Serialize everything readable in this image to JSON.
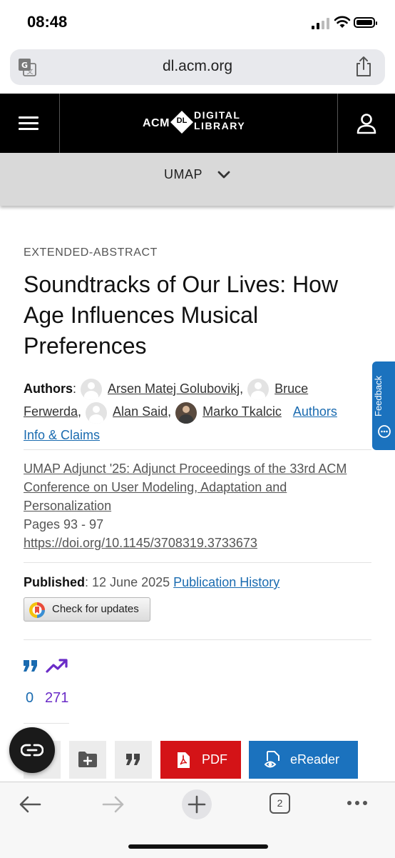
{
  "status_bar": {
    "time": "08:48"
  },
  "browser": {
    "url": "dl.acm.org",
    "tab_count": "2"
  },
  "site": {
    "logo_acm": "ACM",
    "logo_dl": "DL",
    "logo_line1": "DIGITAL",
    "logo_line2": "LIBRARY",
    "conference": "UMAP"
  },
  "article": {
    "type": "EXTENDED-ABSTRACT",
    "title": "Soundtracks of Our Lives: How Age Influences Musical Preferences",
    "authors_label": "Authors",
    "authors": [
      "Arsen Matej Golubovikj",
      "Bruce Ferwerda",
      "Alan Said",
      "Marko Tkalcic"
    ],
    "authors_info_link": "Authors Info & Claims",
    "venue": "UMAP Adjunct '25: Adjunct Proceedings of the 33rd ACM Conference on User Modeling, Adaptation and Personalization",
    "pages": "Pages 93 - 97",
    "doi": "https://doi.org/10.1145/3708319.3733673",
    "published_label": "Published",
    "published_date": "12 June 2025",
    "publication_history_link": "Publication History",
    "check_updates_label": "Check for updates",
    "citations": "0",
    "downloads": "271"
  },
  "actions": {
    "pdf_label": "PDF",
    "ereader_label": "eReader"
  },
  "feedback_label": "Feedback",
  "colors": {
    "header_bg": "#000000",
    "link_blue": "#1a6bb0",
    "pdf_red": "#d41317",
    "ereader_blue": "#1b72be",
    "download_purple": "#6a2cc7"
  }
}
